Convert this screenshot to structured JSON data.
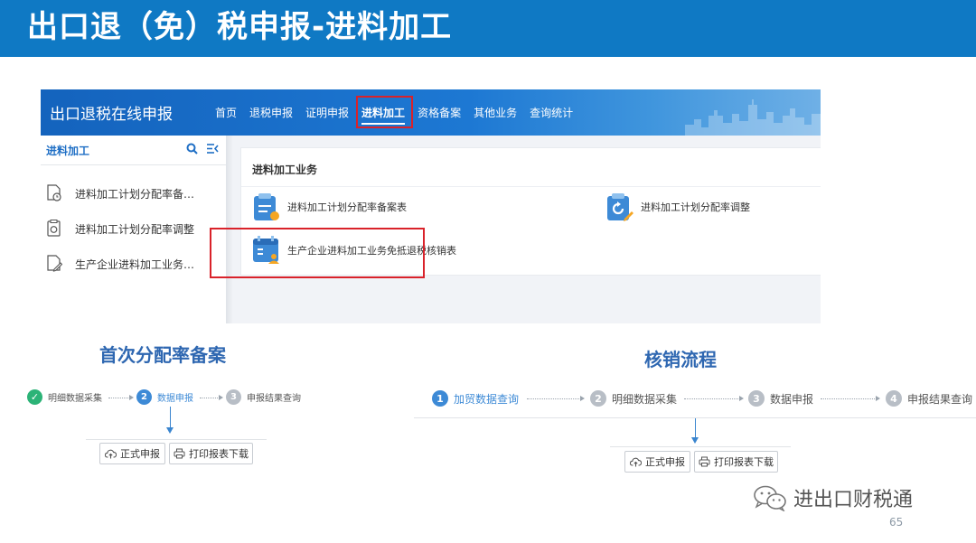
{
  "slide": {
    "title": "出口退（免）税申报-进料加工",
    "page_number": "65",
    "watermark": "进出口财税通"
  },
  "portal": {
    "name": "出口退税在线申报",
    "nav": [
      "首页",
      "退税申报",
      "证明申报",
      "进料加工",
      "资格备案",
      "其他业务",
      "查询统计"
    ],
    "active_nav": "进料加工",
    "sidebar": {
      "title": "进料加工",
      "items": [
        {
          "label": "进料加工计划分配率备…",
          "icon": "doc-clock-icon"
        },
        {
          "label": "进料加工计划分配率调整",
          "icon": "doc-refresh-icon"
        },
        {
          "label": "生产企业进料加工业务…",
          "icon": "doc-edit-icon"
        }
      ]
    },
    "business": {
      "title": "进料加工业务",
      "items": [
        {
          "label": "进料加工计划分配率备案表",
          "icon": "form-doc-icon"
        },
        {
          "label": "进料加工计划分配率调整",
          "icon": "form-refresh-icon"
        },
        {
          "label": "生产企业进料加工业务免抵退税核销表",
          "icon": "form-calendar-icon"
        }
      ]
    }
  },
  "flow_first": {
    "title": "首次分配率备案",
    "steps": [
      {
        "num": "✓",
        "label": "明细数据采集",
        "state": "done"
      },
      {
        "num": "2",
        "label": "数据申报",
        "state": "active"
      },
      {
        "num": "3",
        "label": "申报结果查询",
        "state": "pending"
      }
    ],
    "buttons": [
      "正式申报",
      "打印报表下载"
    ]
  },
  "flow_verify": {
    "title": "核销流程",
    "steps": [
      {
        "num": "1",
        "label": "加贸数据查询",
        "state": "active"
      },
      {
        "num": "2",
        "label": "明细数据采集",
        "state": "pending"
      },
      {
        "num": "3",
        "label": "数据申报",
        "state": "pending"
      },
      {
        "num": "4",
        "label": "申报结果查询",
        "state": "pending"
      }
    ],
    "buttons": [
      "正式申报",
      "打印报表下载"
    ]
  },
  "colors": {
    "header_blue": "#0f79c4",
    "highlight_red": "#d9222a",
    "step_active": "#3d8ad6",
    "step_done": "#2cb377",
    "step_pending": "#b8bec6"
  }
}
